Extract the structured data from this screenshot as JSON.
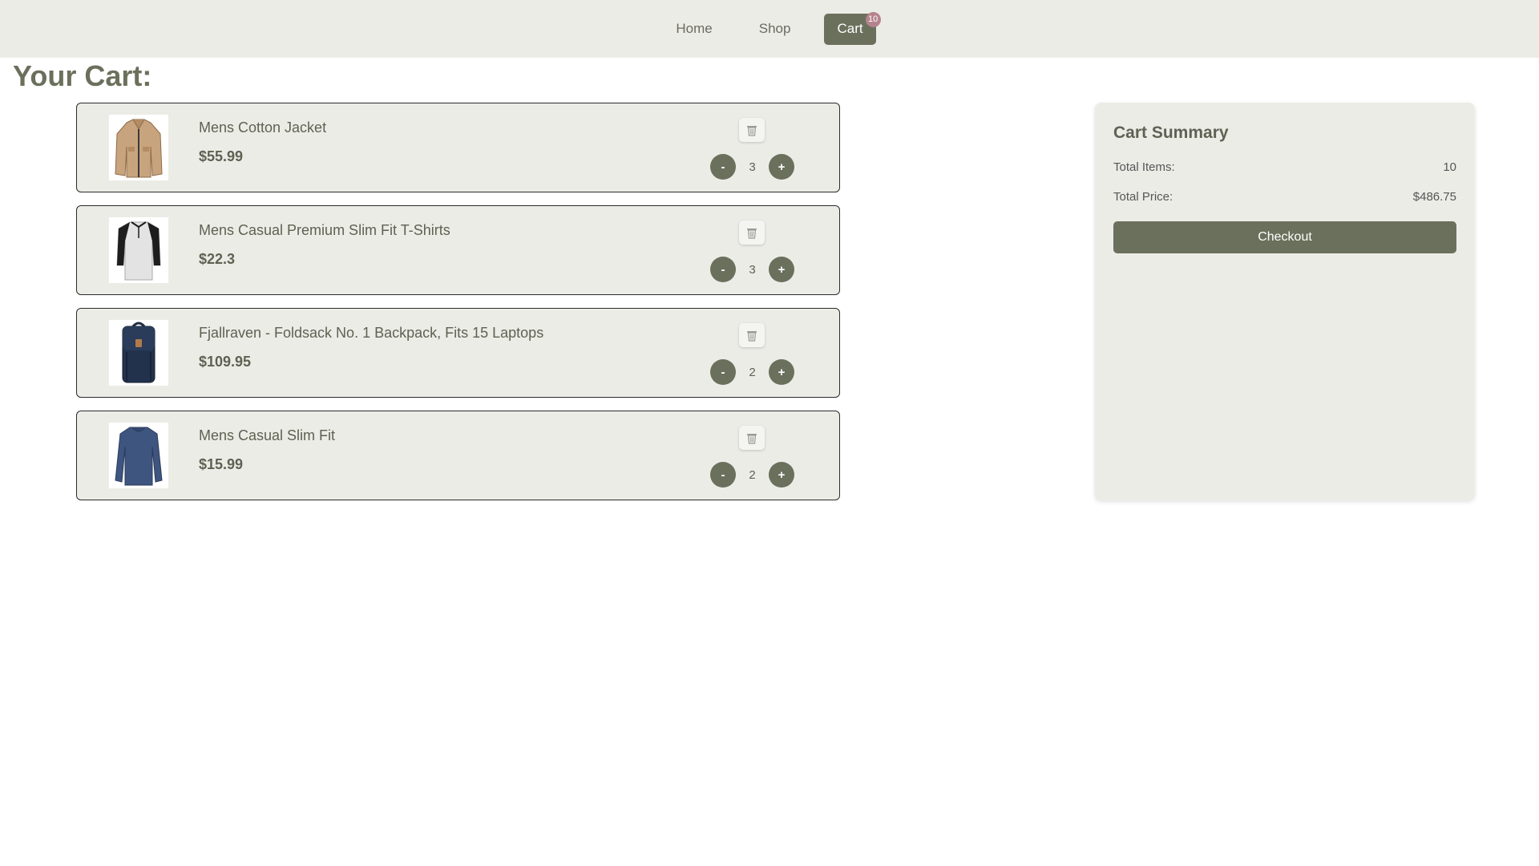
{
  "nav": {
    "items": [
      {
        "label": "Home"
      },
      {
        "label": "Shop"
      },
      {
        "label": "Cart",
        "badge": "10"
      }
    ]
  },
  "page": {
    "title": "Your Cart:"
  },
  "cart": {
    "items": [
      {
        "name": "Mens Cotton Jacket",
        "price": "$55.99",
        "quantity": "3",
        "image_icon": "jacket-icon"
      },
      {
        "name": "Mens Casual Premium Slim Fit T-Shirts",
        "price": "$22.3",
        "quantity": "3",
        "image_icon": "shirt-icon"
      },
      {
        "name": "Fjallraven - Foldsack No. 1 Backpack, Fits 15 Laptops",
        "price": "$109.95",
        "quantity": "2",
        "image_icon": "backpack-icon"
      },
      {
        "name": "Mens Casual Slim Fit",
        "price": "$15.99",
        "quantity": "2",
        "image_icon": "longsleeve-icon"
      }
    ],
    "minus_label": "-",
    "plus_label": "+"
  },
  "summary": {
    "title": "Cart Summary",
    "total_items_label": "Total Items:",
    "total_items_value": "10",
    "total_price_label": "Total Price:",
    "total_price_value": "$486.75",
    "checkout_label": "Checkout"
  },
  "colors": {
    "accent": "#6b705c",
    "panel": "#ecece7",
    "badge": "#b5838d"
  }
}
